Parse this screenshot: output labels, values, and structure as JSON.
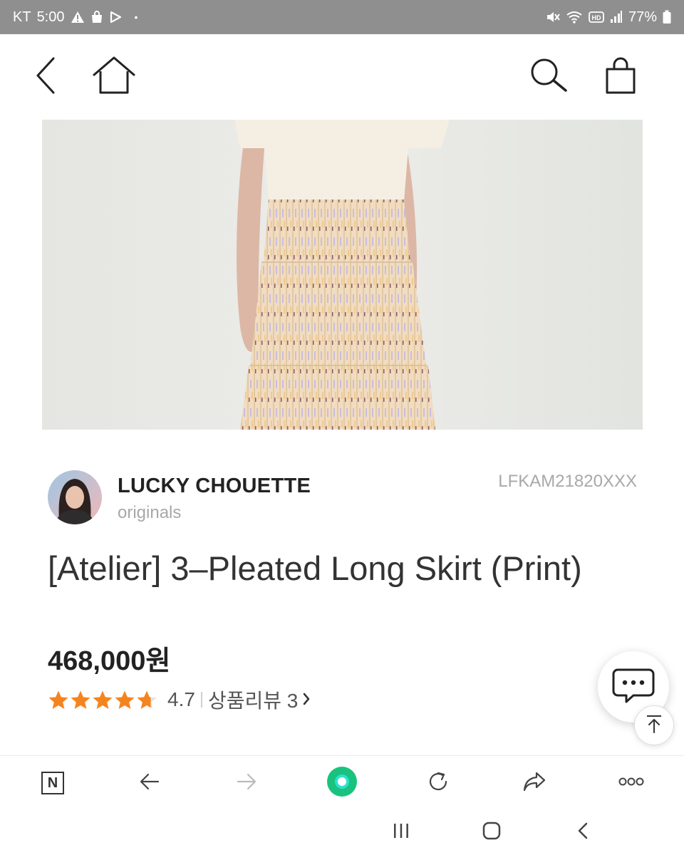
{
  "status_bar": {
    "carrier": "KT",
    "time": "5:00",
    "dot": "•",
    "battery_percent": "77%",
    "left_icons": [
      "warning-icon",
      "bag-icon",
      "play-icon"
    ],
    "right_icons": [
      "mute-icon",
      "wifi-icon",
      "hd-icon",
      "signal-icon",
      "battery-icon"
    ]
  },
  "header": {
    "icons": [
      "back-arrow-icon",
      "home-icon",
      "search-icon",
      "shopping-bag-icon"
    ]
  },
  "product": {
    "brand_name": "LUCKY CHOUETTE",
    "brand_sub": "originals",
    "code": "LFKAM21820XXX",
    "title": "[Atelier] 3–Pleated Long Skirt (Print)",
    "price": "468,000원",
    "rating_value": "4.7",
    "rating_stars": 4.7,
    "rating_max": 5,
    "review_label": "상품리뷰 3",
    "review_chevron": "›"
  },
  "floating": {
    "icons": [
      "chat-bubble-icon",
      "scroll-top-icon"
    ]
  },
  "browser_toolbar": {
    "icons": [
      "naver-n-icon",
      "back-icon",
      "forward-icon",
      "green-dot-icon",
      "reload-icon",
      "share-icon",
      "more-icon"
    ],
    "n_label": "N"
  },
  "colors": {
    "status_bar_bg": "#8f8f8f",
    "star": "#f5841f",
    "green_button": "#19c37d"
  },
  "nav_bar": {
    "icons": [
      "recent-apps-icon",
      "home-circle-icon",
      "nav-back-icon"
    ]
  }
}
